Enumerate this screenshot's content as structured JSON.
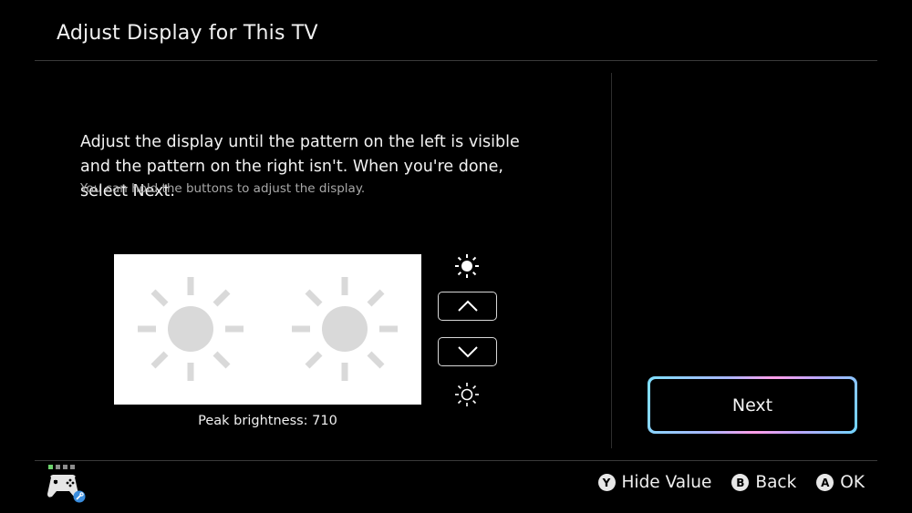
{
  "header": {
    "title": "Adjust Display for This TV"
  },
  "instructions": {
    "main": "Adjust the display until the pattern on the left is visible and the pattern on the right isn't. When you're done, select Next.",
    "hint": "You can hold the buttons to adjust the display."
  },
  "brightness": {
    "label": "Peak brightness: 710"
  },
  "next_button": {
    "label": "Next"
  },
  "footer": {
    "actions": [
      {
        "glyph": "Y",
        "label": "Hide Value"
      },
      {
        "glyph": "B",
        "label": "Back"
      },
      {
        "glyph": "A",
        "label": "OK"
      }
    ],
    "indicator_colors": [
      "#6dd36d",
      "#8c8c8c",
      "#8c8c8c",
      "#8c8c8c"
    ]
  },
  "colors": {
    "background": "#000000",
    "pattern_bg": "#ffffff",
    "pattern_left_sun": "#d9d9d9",
    "pattern_right_sun": "#d9d9d9",
    "next_border_gradient": [
      "#7fe0ff",
      "#a9b7ff",
      "#ff9ee8",
      "#6fd6ff"
    ],
    "controller_badge": "#3a8dde"
  },
  "icons": {
    "brightness_high": "sun-bright-icon",
    "brightness_low": "sun-dim-icon",
    "increase": "chevron-up-icon",
    "decrease": "chevron-down-icon",
    "controller": "controller-icon"
  }
}
